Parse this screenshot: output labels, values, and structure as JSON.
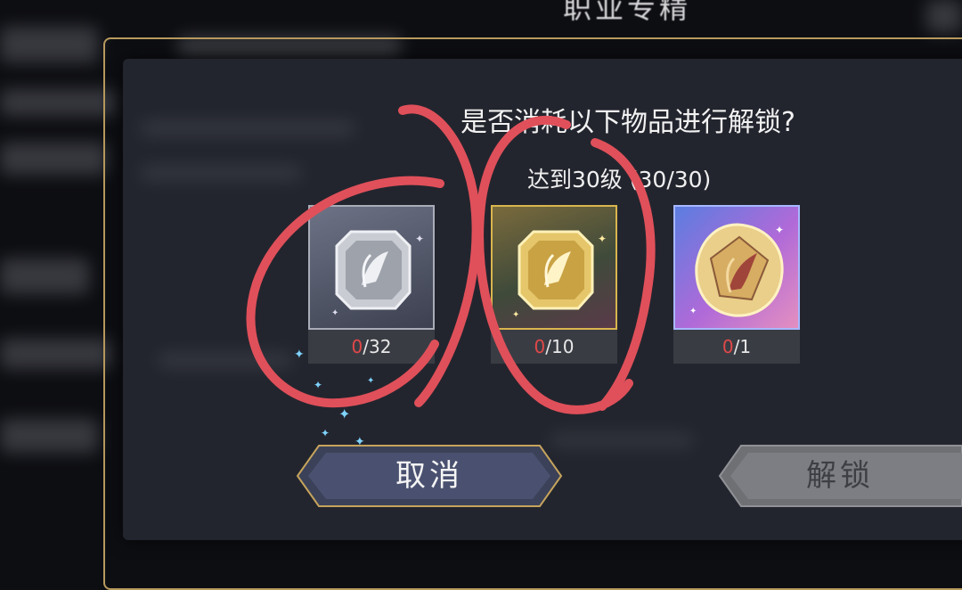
{
  "header": {
    "title": "职业专精"
  },
  "dialog": {
    "prompt": "是否消耗以下物品进行解锁?",
    "requirement": "达到30级 (30/30)",
    "items": [
      {
        "have": "0",
        "need": "/32",
        "icon": "silver-emblem-icon"
      },
      {
        "have": "0",
        "need": "/10",
        "icon": "gold-emblem-icon"
      },
      {
        "have": "0",
        "need": "/1",
        "icon": "prismatic-crest-icon"
      }
    ],
    "buttons": {
      "cancel": "取消",
      "unlock": "解锁"
    }
  },
  "colors": {
    "frame_gold": "#b89a5e",
    "count_red": "#e14848",
    "annotation_red": "#e0505a"
  }
}
